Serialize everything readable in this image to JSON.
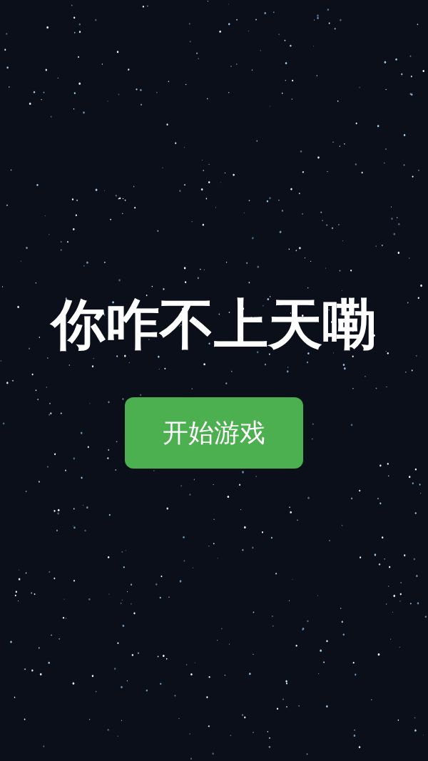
{
  "title": "你咋不上天嘞",
  "start_button": {
    "label": "开始游戏"
  }
}
